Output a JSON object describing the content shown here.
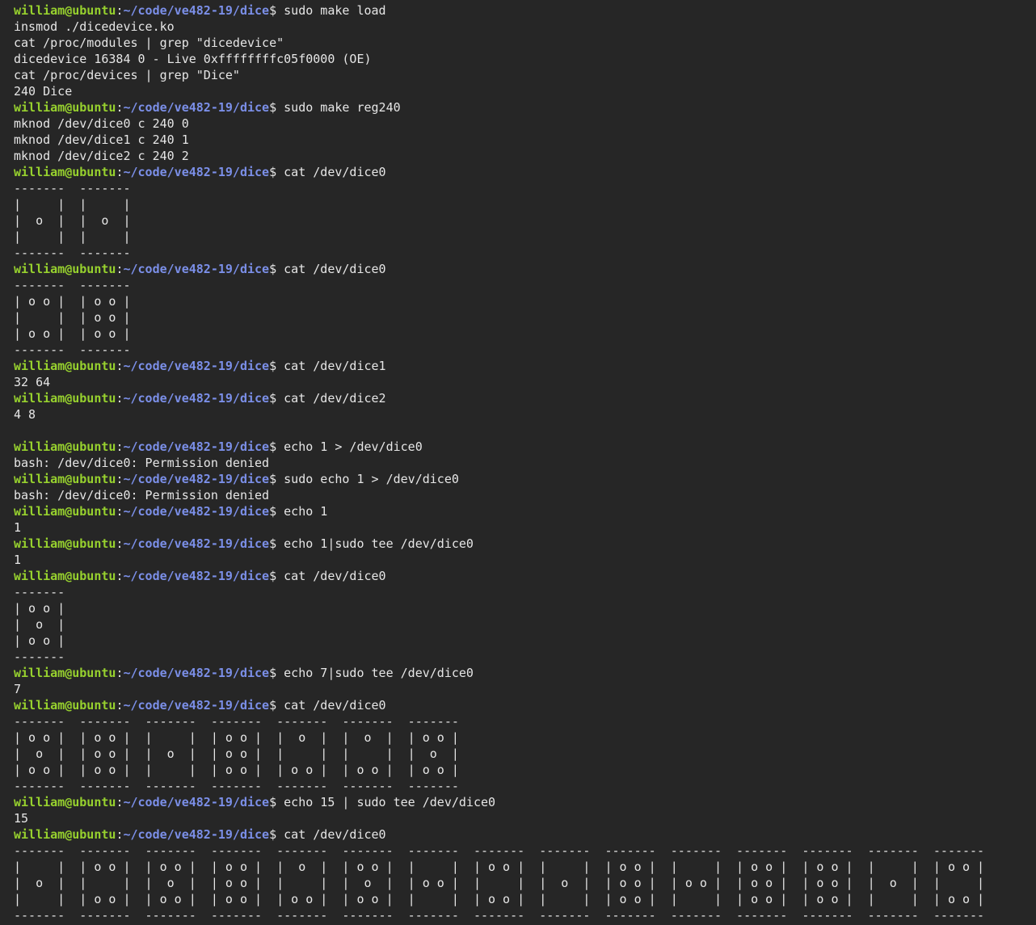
{
  "theme": {
    "background": "#262626",
    "foreground": "#e6e6e6",
    "user_color": "#97d12e",
    "path_color": "#7b8fe8"
  },
  "prompt": {
    "user_host": "william@ubuntu",
    "separator": ":",
    "path": "~/code/ve482-19/dice",
    "symbol": "$"
  },
  "lines": [
    {
      "type": "prompt",
      "text": " sudo make load"
    },
    {
      "type": "output",
      "text": "insmod ./dicedevice.ko"
    },
    {
      "type": "output",
      "text": "cat /proc/modules | grep \"dicedevice\""
    },
    {
      "type": "output",
      "text": "dicedevice 16384 0 - Live 0xffffffffc05f0000 (OE)"
    },
    {
      "type": "output",
      "text": "cat /proc/devices | grep \"Dice\""
    },
    {
      "type": "output",
      "text": "240 Dice"
    },
    {
      "type": "prompt",
      "text": " sudo make reg240"
    },
    {
      "type": "output",
      "text": "mknod /dev/dice0 c 240 0"
    },
    {
      "type": "output",
      "text": "mknod /dev/dice1 c 240 1"
    },
    {
      "type": "output",
      "text": "mknod /dev/dice2 c 240 2"
    },
    {
      "type": "prompt",
      "text": " cat /dev/dice0"
    },
    {
      "type": "output",
      "text": "-------  -------"
    },
    {
      "type": "output",
      "text": "|     |  |     |"
    },
    {
      "type": "output",
      "text": "|  o  |  |  o  |"
    },
    {
      "type": "output",
      "text": "|     |  |     |"
    },
    {
      "type": "output",
      "text": "-------  -------"
    },
    {
      "type": "prompt",
      "text": " cat /dev/dice0"
    },
    {
      "type": "output",
      "text": "-------  -------"
    },
    {
      "type": "output",
      "text": "| o o |  | o o |"
    },
    {
      "type": "output",
      "text": "|     |  | o o |"
    },
    {
      "type": "output",
      "text": "| o o |  | o o |"
    },
    {
      "type": "output",
      "text": "-------  -------"
    },
    {
      "type": "prompt",
      "text": " cat /dev/dice1"
    },
    {
      "type": "output",
      "text": "32 64"
    },
    {
      "type": "prompt",
      "text": " cat /dev/dice2"
    },
    {
      "type": "output",
      "text": "4 8"
    },
    {
      "type": "output",
      "text": ""
    },
    {
      "type": "prompt",
      "text": " echo 1 > /dev/dice0"
    },
    {
      "type": "output",
      "text": "bash: /dev/dice0: Permission denied"
    },
    {
      "type": "prompt",
      "text": " sudo echo 1 > /dev/dice0"
    },
    {
      "type": "output",
      "text": "bash: /dev/dice0: Permission denied"
    },
    {
      "type": "prompt",
      "text": " echo 1"
    },
    {
      "type": "output",
      "text": "1"
    },
    {
      "type": "prompt",
      "text": " echo 1|sudo tee /dev/dice0"
    },
    {
      "type": "output",
      "text": "1"
    },
    {
      "type": "prompt",
      "text": " cat /dev/dice0"
    },
    {
      "type": "output",
      "text": "-------"
    },
    {
      "type": "output",
      "text": "| o o |"
    },
    {
      "type": "output",
      "text": "|  o  |"
    },
    {
      "type": "output",
      "text": "| o o |"
    },
    {
      "type": "output",
      "text": "-------"
    },
    {
      "type": "prompt",
      "text": " echo 7|sudo tee /dev/dice0"
    },
    {
      "type": "output",
      "text": "7"
    },
    {
      "type": "prompt",
      "text": " cat /dev/dice0"
    },
    {
      "type": "output",
      "text": "-------  -------  -------  -------  -------  -------  -------"
    },
    {
      "type": "output",
      "text": "| o o |  | o o |  |     |  | o o |  |  o  |  |  o  |  | o o |"
    },
    {
      "type": "output",
      "text": "|  o  |  | o o |  |  o  |  | o o |  |     |  |     |  |  o  |"
    },
    {
      "type": "output",
      "text": "| o o |  | o o |  |     |  | o o |  | o o |  | o o |  | o o |"
    },
    {
      "type": "output",
      "text": "-------  -------  -------  -------  -------  -------  -------"
    },
    {
      "type": "prompt",
      "text": " echo 15 | sudo tee /dev/dice0"
    },
    {
      "type": "output",
      "text": "15"
    },
    {
      "type": "prompt",
      "text": " cat /dev/dice0"
    },
    {
      "type": "output",
      "text": "-------  -------  -------  -------  -------  -------  -------  -------  -------  -------  -------  -------  -------  -------  -------"
    },
    {
      "type": "output",
      "text": "|     |  | o o |  | o o |  | o o |  |  o  |  | o o |  |     |  | o o |  |     |  | o o |  |     |  | o o |  | o o |  |     |  | o o |"
    },
    {
      "type": "output",
      "text": "|  o  |  |     |  |  o  |  | o o |  |     |  |  o  |  | o o |  |     |  |  o  |  | o o |  | o o |  | o o |  | o o |  |  o  |  |     |"
    },
    {
      "type": "output",
      "text": "|     |  | o o |  | o o |  | o o |  | o o |  | o o |  |     |  | o o |  |     |  | o o |  |     |  | o o |  | o o |  |     |  | o o |"
    },
    {
      "type": "output",
      "text": "-------  -------  -------  -------  -------  -------  -------  -------  -------  -------  -------  -------  -------  -------  -------"
    }
  ]
}
